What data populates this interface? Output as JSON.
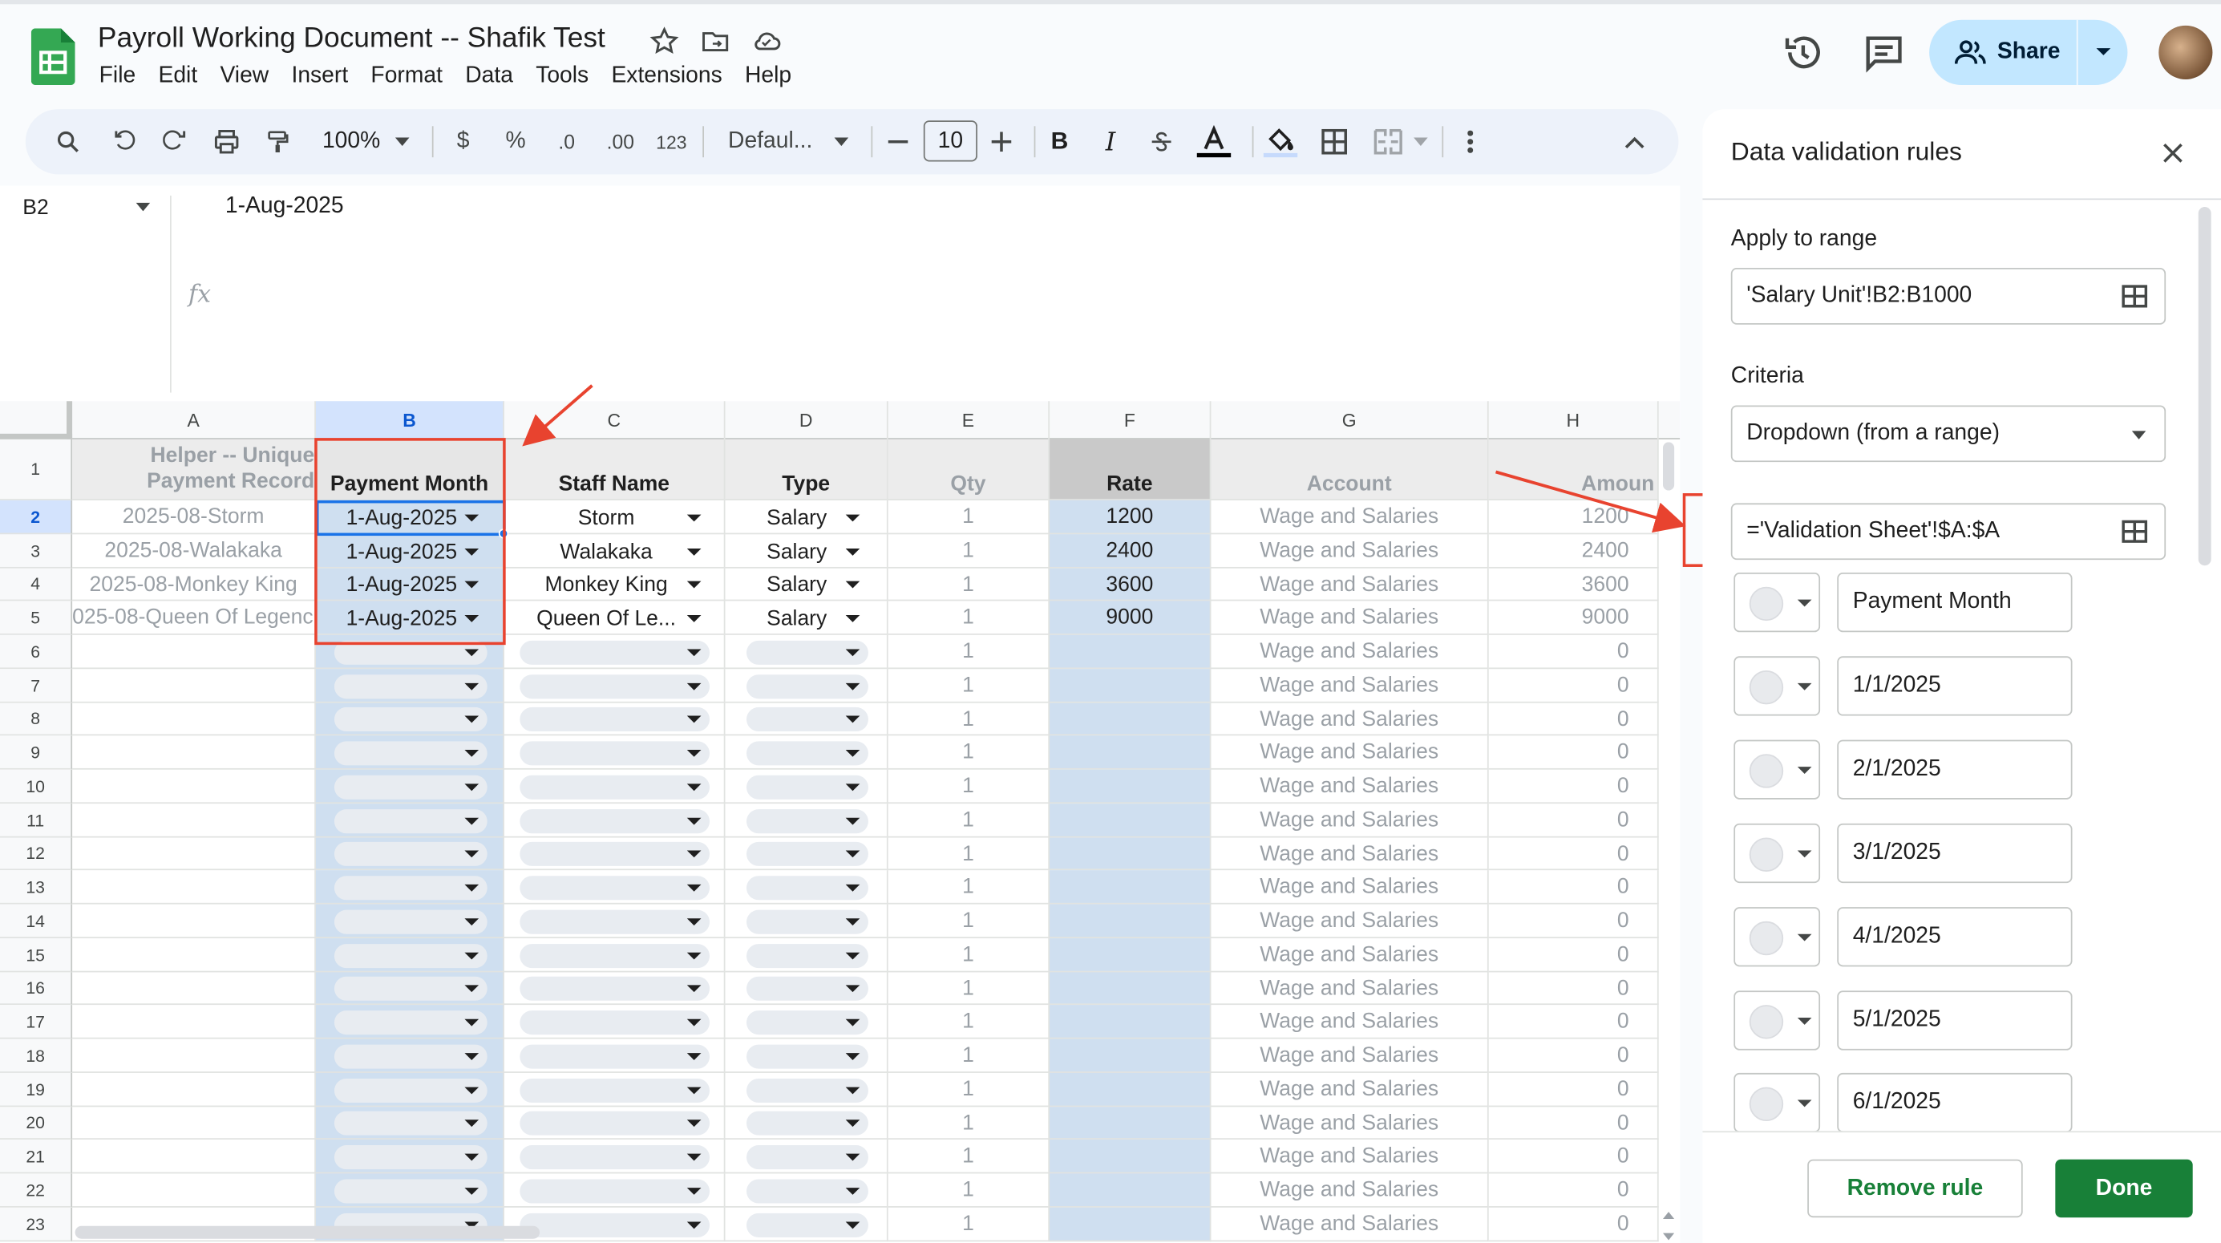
{
  "document": {
    "title": "Payroll Working Document -- Shafik Test"
  },
  "menu": [
    "File",
    "Edit",
    "View",
    "Insert",
    "Format",
    "Data",
    "Tools",
    "Extensions",
    "Help"
  ],
  "share": {
    "label": "Share"
  },
  "toolbar": {
    "zoom": "100%",
    "currency": "$",
    "percent": "%",
    "dec_decrease": ".0",
    "dec_increase": ".00",
    "number_format": "123",
    "font": "Defaul...",
    "font_size": "10",
    "bold": "B",
    "italic": "I"
  },
  "formula_bar": {
    "cell_ref": "B2",
    "value": "1-Aug-2025",
    "fx": "fx"
  },
  "columns": [
    "A",
    "B",
    "C",
    "D",
    "E",
    "F",
    "G",
    "H"
  ],
  "header_row": [
    "Helper -- Unique Payment Record",
    "Payment Month",
    "Staff Name",
    "Type",
    "Qty",
    "Rate",
    "Account",
    "Amoun"
  ],
  "header_a_lines": [
    "Helper -- Unique",
    "Payment Record"
  ],
  "rows": [
    {
      "n": "2",
      "helper": "2025-08-Storm",
      "month": "1-Aug-2025",
      "staff": "Storm",
      "type": "Salary",
      "qty": "1",
      "rate": "1200",
      "account": "Wage and Salaries",
      "amount": "1200"
    },
    {
      "n": "3",
      "helper": "2025-08-Walakaka",
      "month": "1-Aug-2025",
      "staff": "Walakaka",
      "type": "Salary",
      "qty": "1",
      "rate": "2400",
      "account": "Wage and Salaries",
      "amount": "2400"
    },
    {
      "n": "4",
      "helper": "2025-08-Monkey King",
      "month": "1-Aug-2025",
      "staff": "Monkey King",
      "type": "Salary",
      "qty": "1",
      "rate": "3600",
      "account": "Wage and Salaries",
      "amount": "3600"
    },
    {
      "n": "5",
      "helper": "025-08-Queen Of Legenc",
      "month": "1-Aug-2025",
      "staff": "Queen Of Le...",
      "type": "Salary",
      "qty": "1",
      "rate": "9000",
      "account": "Wage and Salaries",
      "amount": "9000"
    },
    {
      "n": "6",
      "qty": "1",
      "account": "Wage and Salaries",
      "amount": "0"
    },
    {
      "n": "7",
      "qty": "1",
      "account": "Wage and Salaries",
      "amount": "0"
    },
    {
      "n": "8",
      "qty": "1",
      "account": "Wage and Salaries",
      "amount": "0"
    },
    {
      "n": "9",
      "qty": "1",
      "account": "Wage and Salaries",
      "amount": "0"
    },
    {
      "n": "10",
      "qty": "1",
      "account": "Wage and Salaries",
      "amount": "0"
    },
    {
      "n": "11",
      "qty": "1",
      "account": "Wage and Salaries",
      "amount": "0"
    },
    {
      "n": "12",
      "qty": "1",
      "account": "Wage and Salaries",
      "amount": "0"
    },
    {
      "n": "13",
      "qty": "1",
      "account": "Wage and Salaries",
      "amount": "0"
    },
    {
      "n": "14",
      "qty": "1",
      "account": "Wage and Salaries",
      "amount": "0"
    },
    {
      "n": "15",
      "qty": "1",
      "account": "Wage and Salaries",
      "amount": "0"
    },
    {
      "n": "16",
      "qty": "1",
      "account": "Wage and Salaries",
      "amount": "0"
    },
    {
      "n": "17",
      "qty": "1",
      "account": "Wage and Salaries",
      "amount": "0"
    },
    {
      "n": "18",
      "qty": "1",
      "account": "Wage and Salaries",
      "amount": "0"
    },
    {
      "n": "19",
      "qty": "1",
      "account": "Wage and Salaries",
      "amount": "0"
    },
    {
      "n": "20",
      "qty": "1",
      "account": "Wage and Salaries",
      "amount": "0"
    },
    {
      "n": "21",
      "qty": "1",
      "account": "Wage and Salaries",
      "amount": "0"
    },
    {
      "n": "22",
      "qty": "1",
      "account": "Wage and Salaries",
      "amount": "0"
    },
    {
      "n": "23",
      "qty": "1",
      "account": "Wage and Salaries",
      "amount": "0"
    }
  ],
  "panel": {
    "title": "Data validation rules",
    "apply_label": "Apply to range",
    "apply_value": "'Salary Unit'!B2:B1000",
    "criteria_label": "Criteria",
    "criteria_value": "Dropdown (from a range)",
    "range_value": "='Validation Sheet'!$A:$A",
    "items": [
      "Payment Month",
      "1/1/2025",
      "2/1/2025",
      "3/1/2025",
      "4/1/2025",
      "5/1/2025",
      "6/1/2025"
    ],
    "remove_label": "Remove rule",
    "done_label": "Done"
  },
  "colors": {
    "accent_green": "#188038",
    "share_blue": "#c2e7ff",
    "annotation_red": "#e8432f",
    "selection_blue": "#d3e3fd"
  }
}
